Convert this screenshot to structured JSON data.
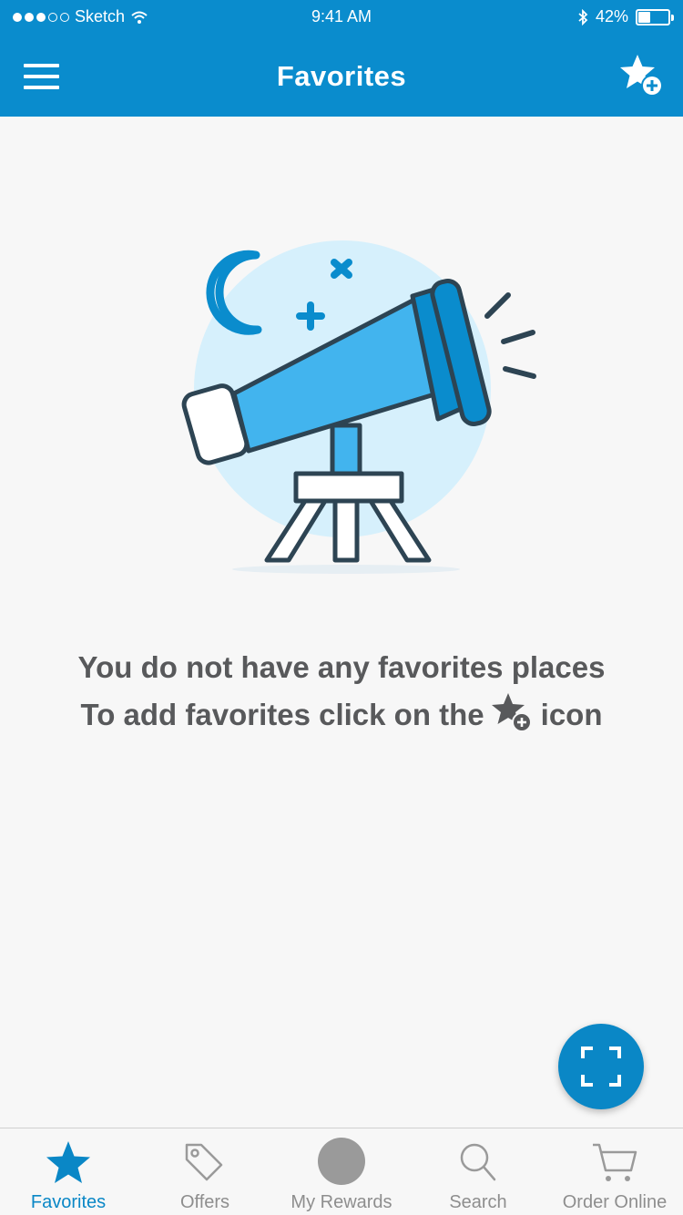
{
  "status_bar": {
    "carrier": "Sketch",
    "time": "9:41 AM",
    "battery_percent": "42%",
    "battery_level": 0.42
  },
  "header": {
    "title": "Favorites"
  },
  "empty_state": {
    "line1": "You do not have any favorites places",
    "line2_before": "To add favorites click on the",
    "line2_after": "icon"
  },
  "tabs": [
    {
      "label": "Favorites",
      "icon": "star-icon",
      "active": true
    },
    {
      "label": "Offers",
      "icon": "tag-icon",
      "active": false
    },
    {
      "label": "My Rewards",
      "icon": "rewards-circle-icon",
      "active": false
    },
    {
      "label": "Search",
      "icon": "search-icon",
      "active": false
    },
    {
      "label": "Order Online",
      "icon": "cart-icon",
      "active": false
    }
  ],
  "colors": {
    "brand": "#0a8ccd",
    "active_tab": "#0a87c6",
    "inactive_tab": "#8e8e8e",
    "text": "#58595b",
    "background": "#f7f7f7"
  }
}
